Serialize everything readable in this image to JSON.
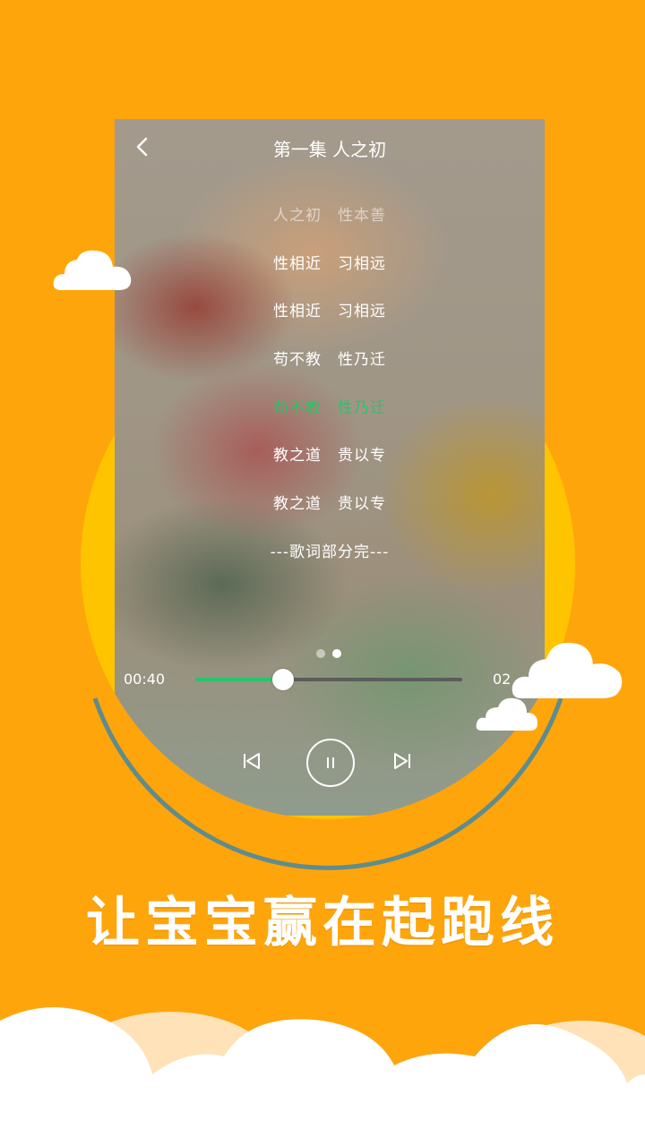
{
  "header": {
    "title": "第一集 人之初"
  },
  "lyrics": [
    {
      "text": "人之初　性本善",
      "state": "dim"
    },
    {
      "text": "性相近　习相远",
      "state": "normal"
    },
    {
      "text": "性相近　习相远",
      "state": "normal"
    },
    {
      "text": "苟不教　性乃迁",
      "state": "normal"
    },
    {
      "text": "苟不教　性乃迁",
      "state": "active"
    },
    {
      "text": "教之道　贵以专",
      "state": "normal"
    },
    {
      "text": "教之道　贵以专",
      "state": "normal"
    },
    {
      "text": "---歌词部分完---",
      "state": "normal"
    }
  ],
  "player": {
    "current_time": "00:40",
    "total_time": "02",
    "progress": 0.33,
    "page_indicator": {
      "count": 2,
      "active": 1
    }
  },
  "controls": {
    "prev_icon": "skip-previous-icon",
    "pause_icon": "pause-icon",
    "next_icon": "skip-next-icon"
  },
  "slogan": "让宝宝赢在起跑线",
  "colors": {
    "background": "#FFA50C",
    "circle": "#FFC400",
    "accent": "#27C46A",
    "cloud": "#FFFFFF",
    "cloud_shadow": "#FFE2B8"
  }
}
